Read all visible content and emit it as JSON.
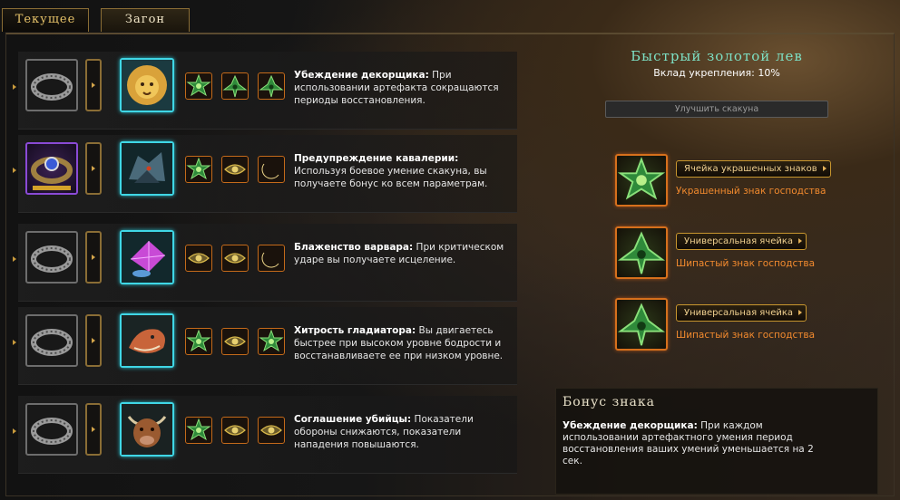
{
  "tabs": [
    {
      "label": "Текущее",
      "active": false
    },
    {
      "label": "Загон",
      "active": true
    }
  ],
  "rows": [
    {
      "gear_icon": "belt-icon",
      "gear_rarity": "common",
      "mount_icon": "lion-portrait-icon",
      "insignias": [
        "green-star-insignia-icon",
        "green-tri-insignia-icon",
        "green-tri-insignia-icon"
      ],
      "desc_name": "Убеждение декорщика:",
      "desc_text": " При использовании артефакта сокращаются периоды восстановления."
    },
    {
      "gear_icon": "ornate-belt-icon",
      "gear_rarity": "epic",
      "mount_icon": "beast-portrait-icon",
      "insignias": [
        "green-star-insignia-icon",
        "gold-eye-insignia-icon",
        "gold-crescent-insignia-icon"
      ],
      "desc_name": "Предупреждение кавалерии:",
      "desc_text": " Используя боевое умение скакуна, вы получаете бонус ко всем параметрам."
    },
    {
      "gear_icon": "belt-icon",
      "gear_rarity": "common",
      "mount_icon": "crystal-portrait-icon",
      "insignias": [
        "gold-eye-insignia-icon",
        "gold-eye-insignia-icon",
        "gold-crescent-insignia-icon"
      ],
      "desc_name": "Блаженство варвара:",
      "desc_text": " При критическом ударе вы получаете исцеление."
    },
    {
      "gear_icon": "belt-icon",
      "gear_rarity": "common",
      "mount_icon": "lizard-portrait-icon",
      "insignias": [
        "green-star-insignia-icon",
        "gold-eye-insignia-icon",
        "green-star-insignia-icon"
      ],
      "desc_name": "Хитрость гладиатора:",
      "desc_text": " Вы двигаетесь быстрее при высоком уровне бодрости и восстанавливаете ее при низком уровне."
    },
    {
      "gear_icon": "belt-icon",
      "gear_rarity": "common",
      "mount_icon": "minotaur-portrait-icon",
      "insignias": [
        "green-star-insignia-icon",
        "gold-eye-insignia-icon",
        "gold-eye-insignia-icon"
      ],
      "desc_name": "Соглашение убийцы:",
      "desc_text": " Показатели обороны снижаются, показатели нападения повышаются."
    }
  ],
  "mount": {
    "title": "Быстрый золотой лев",
    "reinforce": "Вклад укрепления: 10%",
    "upgrade_label": "Улучшить скакуна"
  },
  "slots": [
    {
      "button": "Ячейка украшенных знаков",
      "item": "Украшенный знак господства",
      "icon": "green-star-insignia-icon"
    },
    {
      "button": "Универсальная ячейка",
      "item": "Шипастый знак господства",
      "icon": "green-tri-insignia-icon"
    },
    {
      "button": "Универсальная ячейка",
      "item": "Шипастый знак господства",
      "icon": "green-tri-insignia-icon"
    }
  ],
  "bonus": {
    "title": "Бонус знака",
    "name": "Убеждение декорщика:",
    "text": " При каждом использовании артефактного умения период восстановления ваших умений уменьшается на 2 сек."
  },
  "colors": {
    "accent_gold": "#e8c46a",
    "mount_border": "#3fd7e6",
    "insignia_border": "#c46a1a",
    "slot_orange": "#f28a2e",
    "title_teal": "#7de0c4",
    "epic_purple": "#8a4ad6"
  }
}
